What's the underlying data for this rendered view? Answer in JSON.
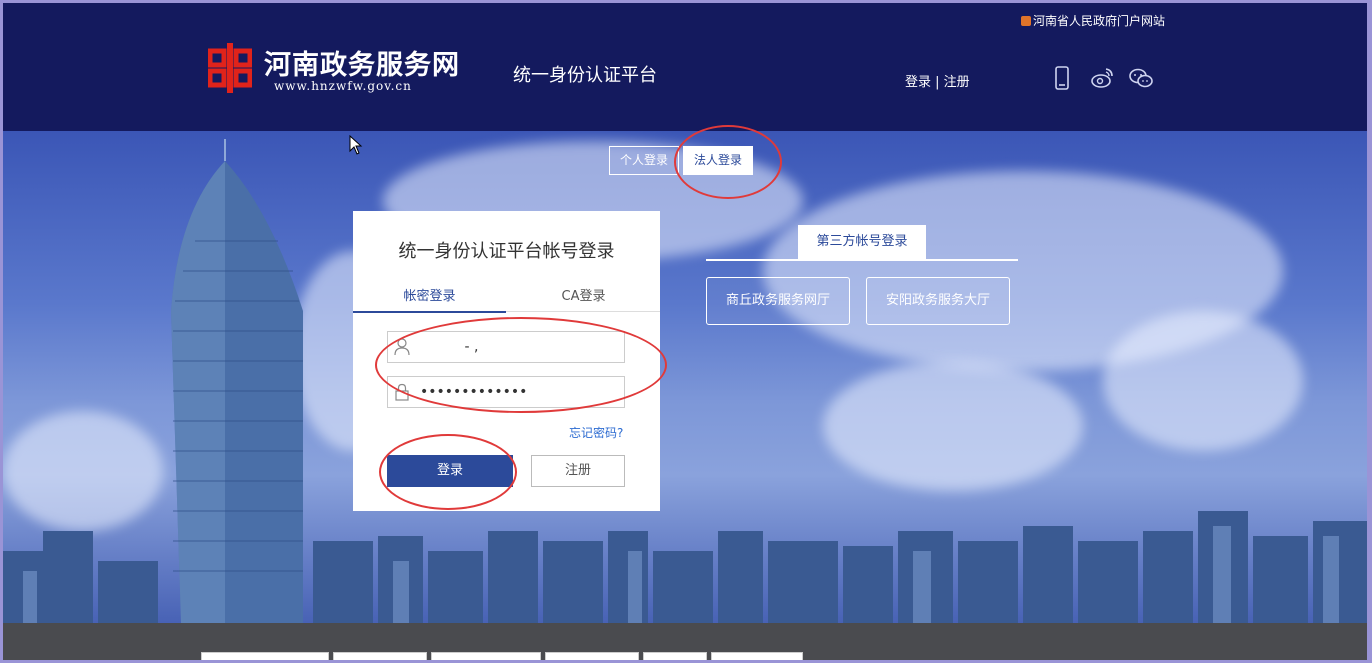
{
  "header": {
    "gov_portal_link": "河南省人民政府门户网站",
    "logo_cn": "河南政务服务网",
    "logo_en": "www.hnzwfw.gov.cn",
    "platform_title": "统一身份认证平台",
    "login_link": "登录",
    "separator": " | ",
    "register_link": "注册",
    "icons": [
      "mobile-icon",
      "weibo-icon",
      "wechat-icon"
    ]
  },
  "login_type_tabs": {
    "person": "个人登录",
    "org": "法人登录"
  },
  "login_card": {
    "title": "统一身份认证平台帐号登录",
    "tabs": [
      "帐密登录",
      "CA登录"
    ],
    "username_value": "          - ,",
    "password_value": "•••••••••••••",
    "forgot_password": "忘记密码?",
    "login_button": "登录",
    "register_button": "注册"
  },
  "third_party": {
    "label": "第三方帐号登录",
    "buttons": [
      "商丘政务服务网厅",
      "安阳政务服务大厅"
    ]
  },
  "colors": {
    "header_bg": "#141a5e",
    "brand_blue": "#2c4a9a",
    "logo_red": "#e0231b",
    "annotation_red": "#e03a3a"
  }
}
